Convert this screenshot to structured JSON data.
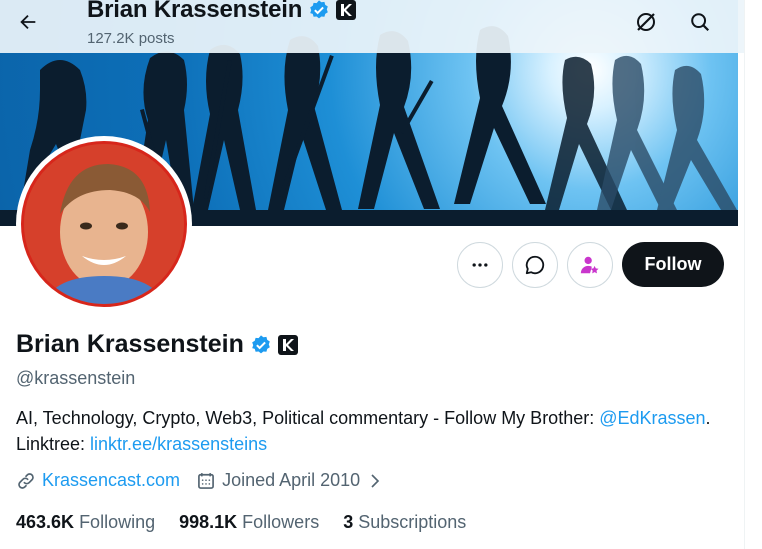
{
  "header": {
    "name": "Brian Krassenstein",
    "posts": "127.2K posts"
  },
  "profile": {
    "name": "Brian Krassenstein",
    "handle": "@krassenstein",
    "bio_text": "AI, Technology, Crypto, Web3, Political commentary - Follow My Brother: ",
    "bio_mention": "@EdKrassen",
    "bio_linktree_label": ". Linktree: ",
    "bio_link": "linktr.ee/krassensteins",
    "website": "Krassencast.com",
    "joined": "Joined April 2010"
  },
  "actions": {
    "follow_label": "Follow"
  },
  "stats": {
    "following_count": "463.6K",
    "following_label": "Following",
    "followers_count": "998.1K",
    "followers_label": "Followers",
    "subscriptions_count": "3",
    "subscriptions_label": "Subscriptions"
  },
  "colors": {
    "verified": "#1d9bf0",
    "link": "#1d9bf0",
    "follow_bg": "#0f1419",
    "subscribe_accent": "#c936cc"
  },
  "icons": [
    "back-arrow-icon",
    "verified-badge-icon",
    "affiliate-badge-icon",
    "grok-icon",
    "search-icon",
    "more-icon",
    "message-icon",
    "subscribe-icon",
    "link-icon",
    "calendar-icon",
    "chevron-right-icon"
  ]
}
